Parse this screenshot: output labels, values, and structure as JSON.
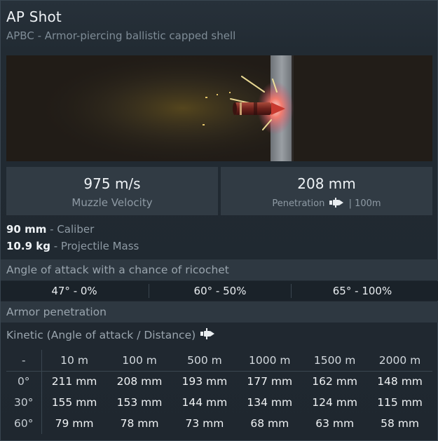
{
  "header": {
    "title": "AP Shot",
    "subtitle": "APBC - Armor-piercing ballistic capped shell"
  },
  "stats": {
    "velocity_value": "975 m/s",
    "velocity_label": "Muzzle Velocity",
    "penetration_value": "208 mm",
    "penetration_label": "Penetration",
    "penetration_icon": "ap-shell-icon",
    "penetration_distance": "| 100m"
  },
  "properties": {
    "caliber_value": "90 mm",
    "caliber_label": "- Caliber",
    "mass_value": "10.9 kg",
    "mass_label": "- Projectile Mass"
  },
  "ricochet": {
    "title": "Angle of attack with a chance of ricochet",
    "items": [
      {
        "angle": "47°",
        "chance": "- 0%"
      },
      {
        "angle": "60°",
        "chance": "- 50%"
      },
      {
        "angle": "65°",
        "chance": "- 100%"
      }
    ]
  },
  "armor_penetration": {
    "title": "Armor penetration",
    "kinetic_label": "Kinetic (Angle of attack / Distance)",
    "kinetic_icon": "ap-shell-icon",
    "corner": "-",
    "distances": [
      "10 m",
      "100 m",
      "500 m",
      "1000 m",
      "1500 m",
      "2000 m"
    ],
    "rows": [
      {
        "angle": "0°",
        "values": [
          "211 mm",
          "208 mm",
          "193 mm",
          "177 mm",
          "162 mm",
          "148 mm"
        ]
      },
      {
        "angle": "30°",
        "values": [
          "155 mm",
          "153 mm",
          "144 mm",
          "134 mm",
          "124 mm",
          "115 mm"
        ]
      },
      {
        "angle": "60°",
        "values": [
          "79 mm",
          "78 mm",
          "73 mm",
          "68 mm",
          "63 mm",
          "58 mm"
        ]
      }
    ]
  },
  "colors": {
    "panel_bg": "#1f272f",
    "section_bg": "#2e3841",
    "stat_bg": "#313b44",
    "armor_plate": "#8a8f94",
    "shell_body": "#7a2a22"
  }
}
